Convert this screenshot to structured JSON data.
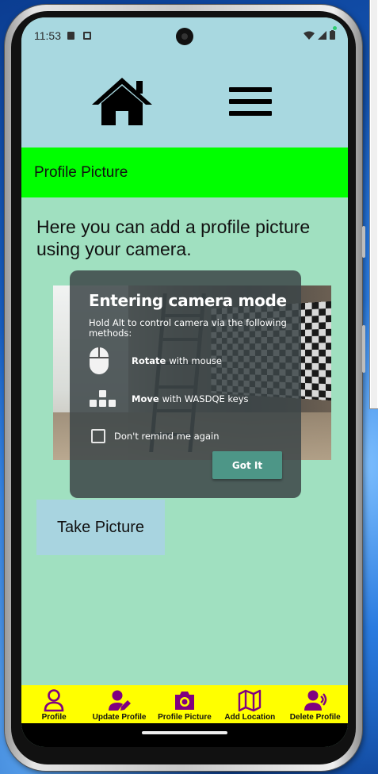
{
  "status_bar": {
    "time": "11:53"
  },
  "header": {
    "home_icon": "home-icon",
    "menu_icon": "hamburger-menu-icon"
  },
  "page": {
    "title": "Profile Picture",
    "intro": "Here you can add a profile picture using your camera.",
    "take_picture_label": "Take Picture"
  },
  "camera_dialog": {
    "title": "Entering camera mode",
    "description": "Hold Alt to control camera via the following methods:",
    "rotate_bold": "Rotate",
    "rotate_rest": "with mouse",
    "move_bold": "Move",
    "move_rest": "with WASDQE keys",
    "dont_remind": "Don't remind me again",
    "got_it": "Got It"
  },
  "bottom_nav": {
    "items": [
      {
        "label": "Profile",
        "icon": "person-icon"
      },
      {
        "label": "Update Profile",
        "icon": "edit-person-icon"
      },
      {
        "label": "Profile Picture",
        "icon": "camera-icon"
      },
      {
        "label": "Add Location",
        "icon": "map-icon"
      },
      {
        "label": "Delete Profile",
        "icon": "person-remove-icon"
      }
    ],
    "color": "#800080",
    "background": "#ffff00"
  },
  "colors": {
    "title_bar": "#00ff00",
    "content_bg": "#a0e0c0",
    "header_bg": "#a8d8e0",
    "got_it_button": "#4d9687"
  }
}
